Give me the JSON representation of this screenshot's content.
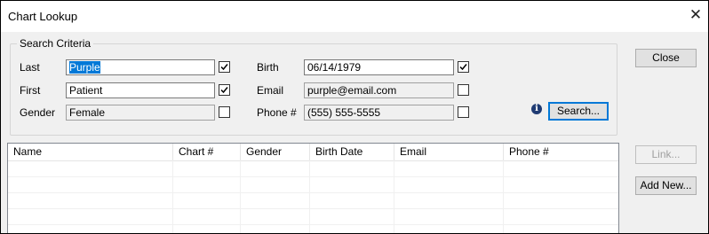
{
  "window": {
    "title": "Chart Lookup"
  },
  "criteria": {
    "group_title": "Search Criteria",
    "last": {
      "label": "Last",
      "value": "Purple",
      "checked": true
    },
    "first": {
      "label": "First",
      "value": "Patient",
      "checked": true
    },
    "gender": {
      "label": "Gender",
      "value": "Female",
      "checked": false
    },
    "birth": {
      "label": "Birth",
      "value": "06/14/1979",
      "checked": true
    },
    "email": {
      "label": "Email",
      "value": "purple@email.com",
      "checked": false
    },
    "phone": {
      "label": "Phone #",
      "value": "(555) 555-5555",
      "checked": false
    }
  },
  "buttons": {
    "search": "Search...",
    "close": "Close",
    "link": "Link...",
    "add_new": "Add New..."
  },
  "results": {
    "columns": [
      "Name",
      "Chart #",
      "Gender",
      "Birth Date",
      "Email",
      "Phone #"
    ],
    "rows": []
  },
  "icons": {
    "info": "info-icon",
    "close": "close-icon",
    "checkbox_check": "checkmark-icon"
  },
  "colors": {
    "selection": "#0078d7",
    "focus_border": "#0078d7",
    "info_icon": "#1f3b73"
  }
}
